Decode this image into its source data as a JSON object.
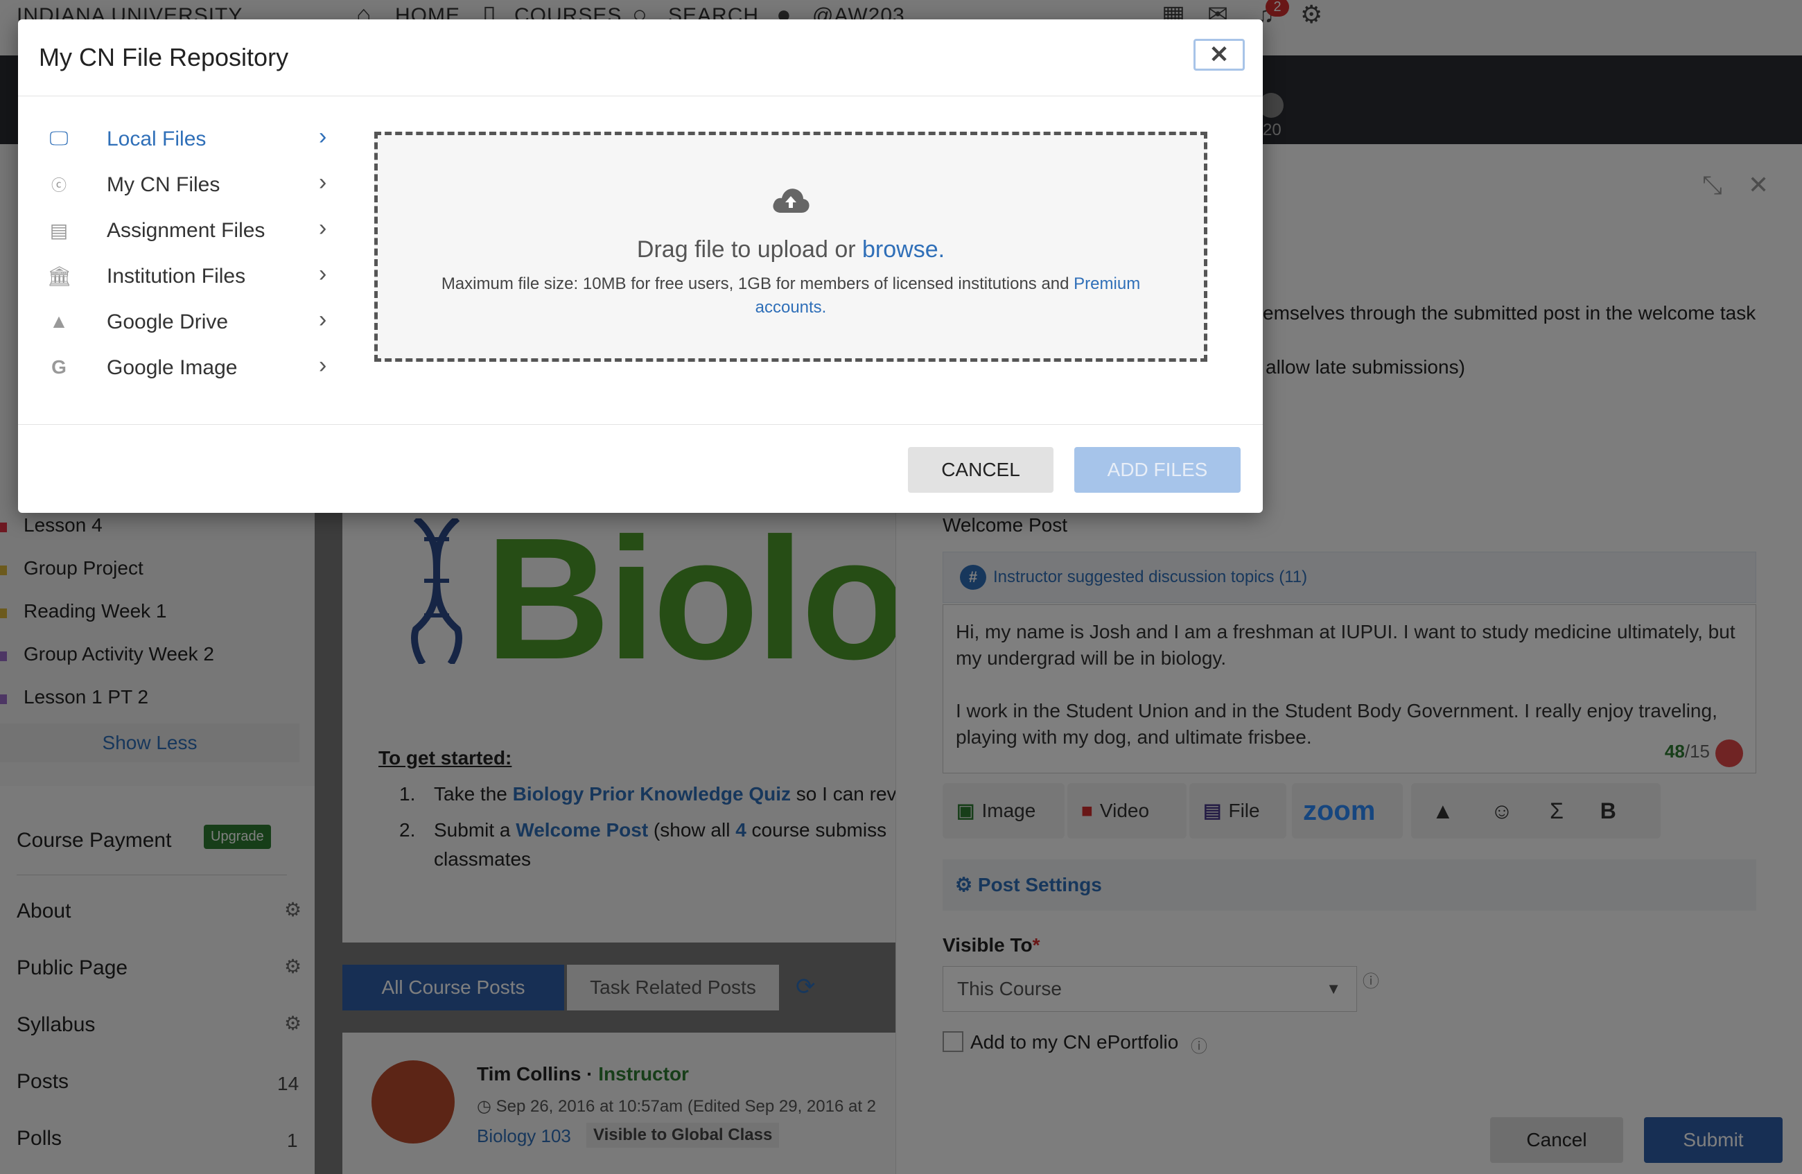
{
  "topnav": {
    "brand": "INDIANA UNIVERSITY",
    "home": "HOME",
    "courses": "COURSES",
    "search": "SEARCH",
    "user": "@AW203",
    "notification_count": "2"
  },
  "banner": {
    "member_count": "20"
  },
  "sidebar": {
    "lessons": [
      "Lesson 4",
      "Group Project",
      "Reading Week 1",
      "Group Activity Week 2",
      "Lesson 1 PT 2"
    ],
    "show_less": "Show Less",
    "course_payment": "Course Payment",
    "upgrade": "Upgrade",
    "links": [
      {
        "label": "About",
        "count": ""
      },
      {
        "label": "Public Page",
        "count": ""
      },
      {
        "label": "Syllabus",
        "count": ""
      },
      {
        "label": "Posts",
        "count": "14"
      },
      {
        "label": "Polls",
        "count": "1"
      }
    ]
  },
  "center": {
    "logo_text": "Biolog",
    "get_started": "To get started:",
    "step1_num": "1.",
    "step1_pre": "Take the ",
    "step1_link": "Biology Prior Knowledge Quiz",
    "step1_post": " so I can rev",
    "step2_num": "2.",
    "step2_pre": "Submit a ",
    "step2_link": "Welcome Post",
    "step2_mid": " (show all ",
    "step2_count": "4",
    "step2_post": " course submiss",
    "step2_cont": "classmates",
    "tab_all": "All Course Posts",
    "tab_task": "Task Related Posts"
  },
  "post": {
    "author": "Tim Collins",
    "role": "Instructor",
    "date": "Sep 26, 2016 at 10:57am (Edited Sep 29, 2016 at 2",
    "course": "Biology 103",
    "visibility": "Visible to Global Class"
  },
  "right_panel": {
    "intro_line1": "emselves through the submitted post in the welcome task",
    "intro_line2": "allow late submissions)",
    "post_title": "Welcome Post",
    "topics": "Instructor suggested discussion topics (11)",
    "body_p1": "Hi, my name is Josh and I am a freshman at IUPUI. I want to study medicine ultimately, but my undergrad will be in biology.",
    "body_p2": "I work in the Student Union and in the Student Body Government. I really enjoy traveling, playing with my dog, and ultimate frisbee.",
    "word_count": "48",
    "word_target": "/15",
    "tools": {
      "image": "Image",
      "video": "Video",
      "file": "File",
      "zoom": "zoom"
    },
    "post_settings": "Post Settings",
    "visible_to_label": "Visible To",
    "visible_to_value": "This Course",
    "eportfolio": "Add to my CN ePortfolio",
    "cancel": "Cancel",
    "submit": "Submit"
  },
  "modal": {
    "title": "My CN File Repository",
    "sources": [
      "Local Files",
      "My CN Files",
      "Assignment Files",
      "Institution Files",
      "Google Drive",
      "Google Image"
    ],
    "active_source": "Local Files",
    "drag_text": "Drag file to upload or ",
    "browse": "browse.",
    "limit_text": "Maximum file size: 10MB for free users, 1GB for members of licensed institutions and ",
    "premium_link": "Premium accounts.",
    "cancel": "CANCEL",
    "add_files": "ADD FILES"
  },
  "colors": {
    "accent": "#2f6fb8",
    "primary_button": "#2f5fa8",
    "success": "#2e7d32",
    "logo_green": "#4c9a2a"
  }
}
